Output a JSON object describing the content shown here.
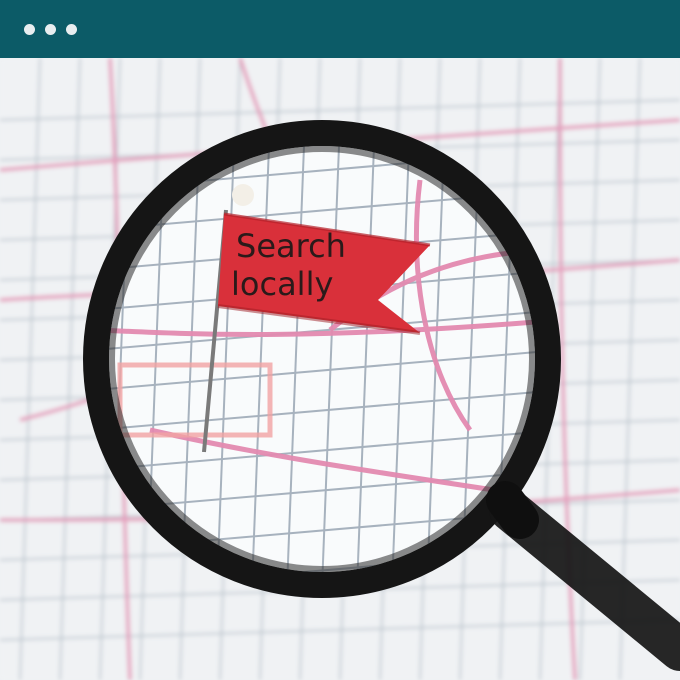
{
  "window": {
    "controls": [
      "dot",
      "dot",
      "dot"
    ],
    "topbar_color": "#0c5b67"
  },
  "scene": {
    "flag": {
      "line1": "Search",
      "line2": "locally",
      "color": "#d9303a"
    },
    "magnifier": {
      "frame_color": "#151515"
    },
    "map": {
      "road_color": "#e38ab0",
      "street_color": "#9aa7b5"
    }
  }
}
